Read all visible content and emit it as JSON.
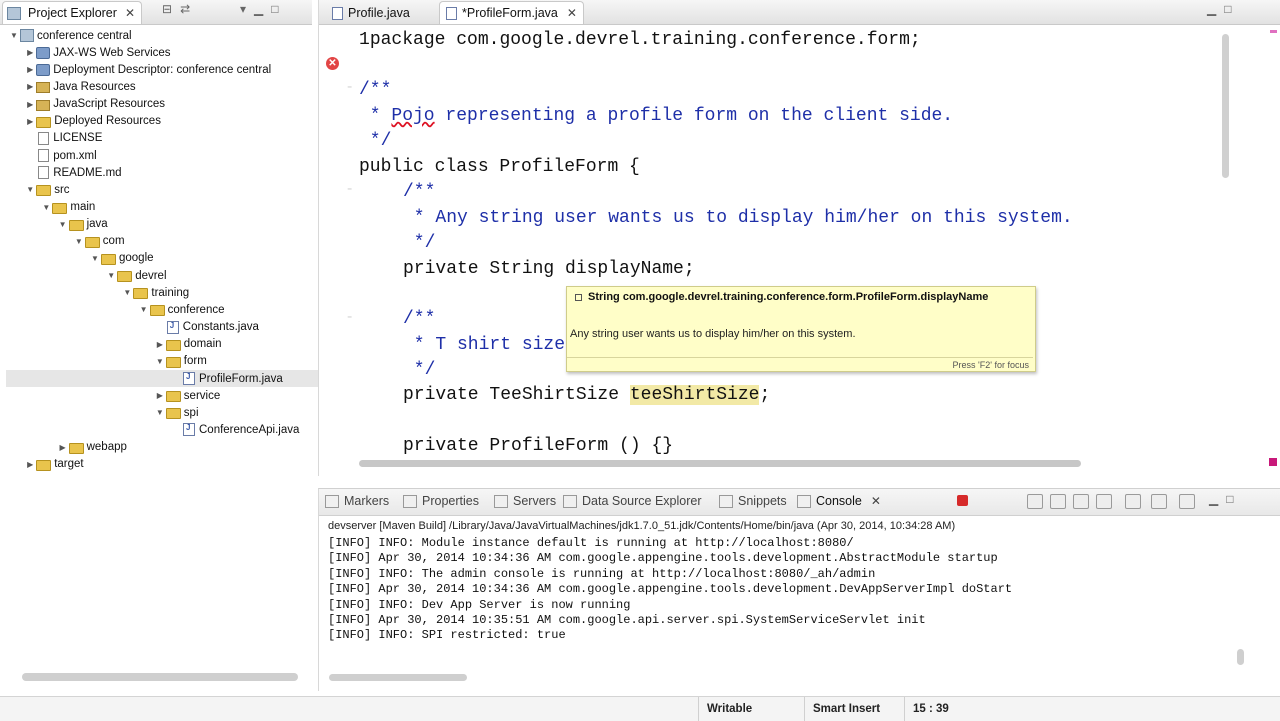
{
  "explorer": {
    "tab_label": "Project Explorer",
    "tree": [
      {
        "label": "conference central",
        "depth": 0,
        "icon": "project-icon",
        "expanded": true
      },
      {
        "label": "JAX-WS Web Services",
        "depth": 1,
        "icon": "webservice-icon",
        "expanded": false
      },
      {
        "label": "Deployment Descriptor: conference central",
        "depth": 1,
        "icon": "descriptor-icon",
        "expanded": false
      },
      {
        "label": "Java Resources",
        "depth": 1,
        "icon": "java-resources-icon",
        "expanded": false
      },
      {
        "label": "JavaScript Resources",
        "depth": 1,
        "icon": "javascript-resources-icon",
        "expanded": false
      },
      {
        "label": "Deployed Resources",
        "depth": 1,
        "icon": "folder-icon",
        "expanded": false
      },
      {
        "label": "LICENSE",
        "depth": 1,
        "icon": "file-icon",
        "leaf": true
      },
      {
        "label": "pom.xml",
        "depth": 1,
        "icon": "file-icon",
        "leaf": true
      },
      {
        "label": "README.md",
        "depth": 1,
        "icon": "file-icon",
        "leaf": true
      },
      {
        "label": "src",
        "depth": 1,
        "icon": "folder-icon",
        "expanded": true
      },
      {
        "label": "main",
        "depth": 2,
        "icon": "folder-icon",
        "expanded": true
      },
      {
        "label": "java",
        "depth": 3,
        "icon": "folder-icon",
        "expanded": true
      },
      {
        "label": "com",
        "depth": 4,
        "icon": "folder-icon",
        "expanded": true
      },
      {
        "label": "google",
        "depth": 5,
        "icon": "folder-icon",
        "expanded": true
      },
      {
        "label": "devrel",
        "depth": 6,
        "icon": "folder-icon",
        "expanded": true
      },
      {
        "label": "training",
        "depth": 7,
        "icon": "folder-icon",
        "expanded": true
      },
      {
        "label": "conference",
        "depth": 8,
        "icon": "folder-icon",
        "expanded": true
      },
      {
        "label": "Constants.java",
        "depth": 9,
        "icon": "java-file-icon",
        "leaf": true
      },
      {
        "label": "domain",
        "depth": 9,
        "icon": "folder-icon",
        "expanded": false
      },
      {
        "label": "form",
        "depth": 9,
        "icon": "folder-icon",
        "expanded": true
      },
      {
        "label": "ProfileForm.java",
        "depth": 10,
        "icon": "java-file-icon",
        "leaf": true,
        "selected": true
      },
      {
        "label": "service",
        "depth": 9,
        "icon": "folder-icon",
        "expanded": false
      },
      {
        "label": "spi",
        "depth": 9,
        "icon": "folder-icon",
        "expanded": true
      },
      {
        "label": "ConferenceApi.java",
        "depth": 10,
        "icon": "java-file-icon",
        "leaf": true
      },
      {
        "label": "webapp",
        "depth": 3,
        "icon": "folder-icon",
        "expanded": false
      },
      {
        "label": "target",
        "depth": 1,
        "icon": "folder-icon",
        "expanded": false
      }
    ]
  },
  "editor": {
    "tabs": [
      {
        "label": "Profile.java",
        "active": false
      },
      {
        "label": "*ProfileForm.java",
        "active": true
      }
    ],
    "code": {
      "l1_num": "1",
      "l1_kw": "package",
      "l1_rest": " com.google.devrel.training.conference.form;",
      "l2": "/**",
      "l3_a": " * ",
      "l3_err": "Pojo",
      "l3_b": " representing a profile form on the client side.",
      "l4": " */",
      "l5": "public class ProfileForm {",
      "l6": "/**",
      "l7": " * Any string user wants us to display him/her on this system.",
      "l8": " */",
      "l9_a": "private String ",
      "l9_hl": "displayName",
      "l9_b": ";",
      "l10": "/**",
      "l11": " * T shirt size",
      "l12": " */",
      "l13_a": "private TeeShirtSize ",
      "l13_hl": "teeShirtSize",
      "l13_b": ";",
      "l14": "private ProfileForm () {}"
    },
    "tooltip": {
      "title": "String com.google.devrel.training.conference.form.ProfileForm.displayName",
      "body": "Any string user wants us to display him/her on this system.",
      "footer": "Press 'F2' for focus"
    }
  },
  "console": {
    "tabs": [
      {
        "label": "Markers",
        "icon": "markers-icon"
      },
      {
        "label": "Properties",
        "icon": "properties-icon"
      },
      {
        "label": "Servers",
        "icon": "servers-icon"
      },
      {
        "label": "Data Source Explorer",
        "icon": "datasource-icon"
      },
      {
        "label": "Snippets",
        "icon": "snippets-icon"
      },
      {
        "label": "Console",
        "icon": "console-icon",
        "active": true
      }
    ],
    "header": "devserver [Maven Build] /Library/Java/JavaVirtualMachines/jdk1.7.0_51.jdk/Contents/Home/bin/java (Apr 30, 2014, 10:34:28 AM)",
    "lines": [
      "[INFO] INFO: Module instance default is running at http://localhost:8080/",
      "[INFO] Apr 30, 2014 10:34:36 AM com.google.appengine.tools.development.AbstractModule startup",
      "[INFO] INFO: The admin console is running at http://localhost:8080/_ah/admin",
      "[INFO] Apr 30, 2014 10:34:36 AM com.google.appengine.tools.development.DevAppServerImpl doStart",
      "[INFO] INFO: Dev App Server is now running",
      "[INFO] Apr 30, 2014 10:35:51 AM com.google.api.server.spi.SystemServiceServlet init",
      "[INFO] INFO: SPI restricted: true"
    ]
  },
  "status": {
    "writable": "Writable",
    "insert_mode": "Smart Insert",
    "position": "15 : 39"
  }
}
